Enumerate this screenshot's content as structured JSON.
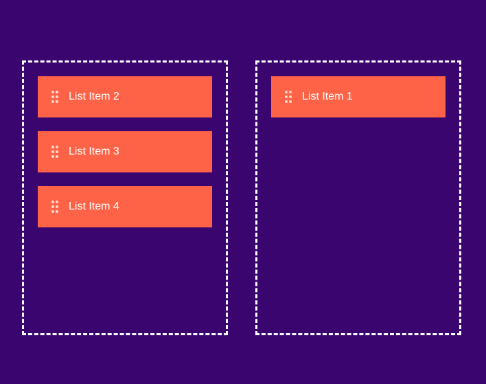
{
  "colors": {
    "background": "#3b056f",
    "item_background": "#ff6347",
    "border": "#ffffff",
    "text": "#ffffff"
  },
  "lists": {
    "left": {
      "items": [
        {
          "label": "List Item 2",
          "icon": "drag-handle-icon"
        },
        {
          "label": "List Item 3",
          "icon": "drag-handle-icon"
        },
        {
          "label": "List Item 4",
          "icon": "drag-handle-icon"
        }
      ]
    },
    "right": {
      "items": [
        {
          "label": "List Item 1",
          "icon": "drag-handle-icon"
        }
      ]
    }
  }
}
